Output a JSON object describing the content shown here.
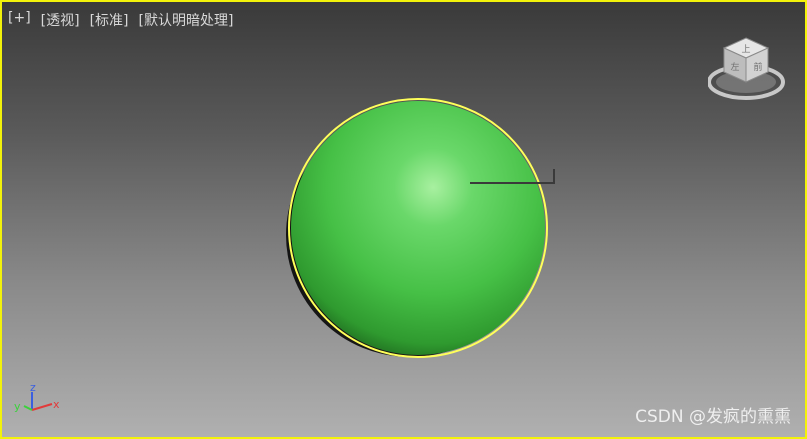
{
  "viewport": {
    "labels": {
      "plus": "[+]",
      "view": "[透视]",
      "shading_style": "[标准]",
      "lighting": "[默认明暗处理]"
    },
    "border_color": "#f2f20a",
    "background_top": "#3a3a3a",
    "background_bottom": "#b0b0b0"
  },
  "viewcube": {
    "top_face": "上",
    "front_face": "前",
    "left_face": "左"
  },
  "scene": {
    "object": "sphere",
    "object_color": "#4fc84f",
    "selection_color": "#ffff5a",
    "selected": true
  },
  "axis_gizmo": {
    "x": "x",
    "y": "y",
    "z": "z"
  },
  "watermark": "CSDN @发疯的熏熏"
}
